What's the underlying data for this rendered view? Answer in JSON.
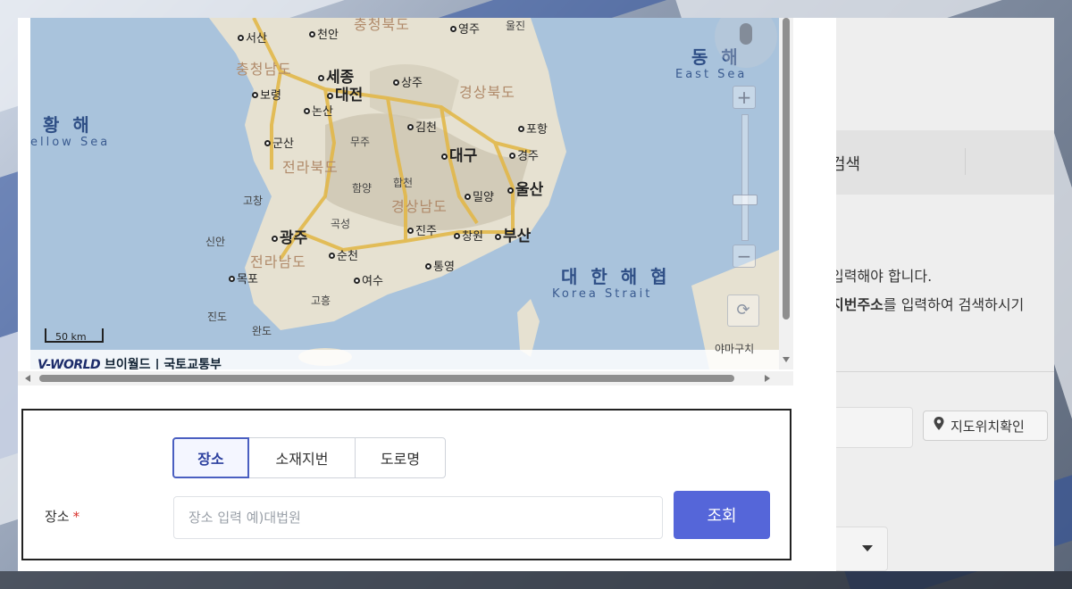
{
  "background_page": {
    "search_tab_partial": "검색",
    "notice_line1": "입력해야 합니다.",
    "notice_line2_bold": "지번주소",
    "notice_line2_rest": "를 입력하여 검색하시기",
    "map_check_button": "지도위치확인"
  },
  "map": {
    "labels": {
      "seosan": "서산",
      "cheonan": "천안",
      "chungbuk": "충청북도",
      "yeongju": "영주",
      "uljin": "울진",
      "chungnam": "충청남도",
      "sejong": "세종",
      "daejeon": "대전",
      "boryeong": "보령",
      "sangju": "상주",
      "gyeongbuk": "경상북도",
      "nonsan": "논산",
      "gimcheon": "김천",
      "pohang": "포항",
      "gunsan": "군산",
      "muju": "무주",
      "daegu": "대구",
      "gyeongju": "경주",
      "jeonbuk": "전라북도",
      "hamyang": "함양",
      "hapcheon": "합천",
      "miryang": "밀양",
      "ulsan": "울산",
      "gochang": "고창",
      "gyeongnam": "경상남도",
      "gokseong": "곡성",
      "jinju": "진주",
      "changwon": "창원",
      "busan": "부산",
      "sinan": "신안",
      "gwangju": "광주",
      "suncheon": "순천",
      "jeonnam": "전라남도",
      "tongyeong": "통영",
      "mokpo": "목포",
      "yeosu": "여수",
      "goheung": "고흥",
      "jindo": "진도",
      "wando": "완도",
      "yamaguchi": "야마구치"
    },
    "seas": {
      "yellow_kr": "황 해",
      "yellow_en": "ellow Sea",
      "east_kr": "동 해",
      "east_en": "East Sea",
      "strait_kr": "대 한 해 협",
      "strait_en": "Korea Strait"
    },
    "scale": "50 km",
    "attribution_logo": "V-WORLD",
    "attribution_text": "브이월드 | 국토교통부",
    "zoom_in": "+",
    "zoom_out": "−",
    "reset_icon": "⟳"
  },
  "form": {
    "tabs": [
      {
        "label": "장소",
        "active": true
      },
      {
        "label": "소재지번",
        "active": false
      },
      {
        "label": "도로명",
        "active": false
      }
    ],
    "field_label": "장소",
    "required_mark": "*",
    "input_value": "",
    "input_placeholder": "장소 입력 예)대법원",
    "submit_label": "조회"
  },
  "colors": {
    "accent": "#5566d9",
    "active_tab_border": "#4a5fc1",
    "required": "#d9302b",
    "sea": "#a9c3dc",
    "land": "#e8e4d6",
    "roads": "#e2b84a"
  }
}
